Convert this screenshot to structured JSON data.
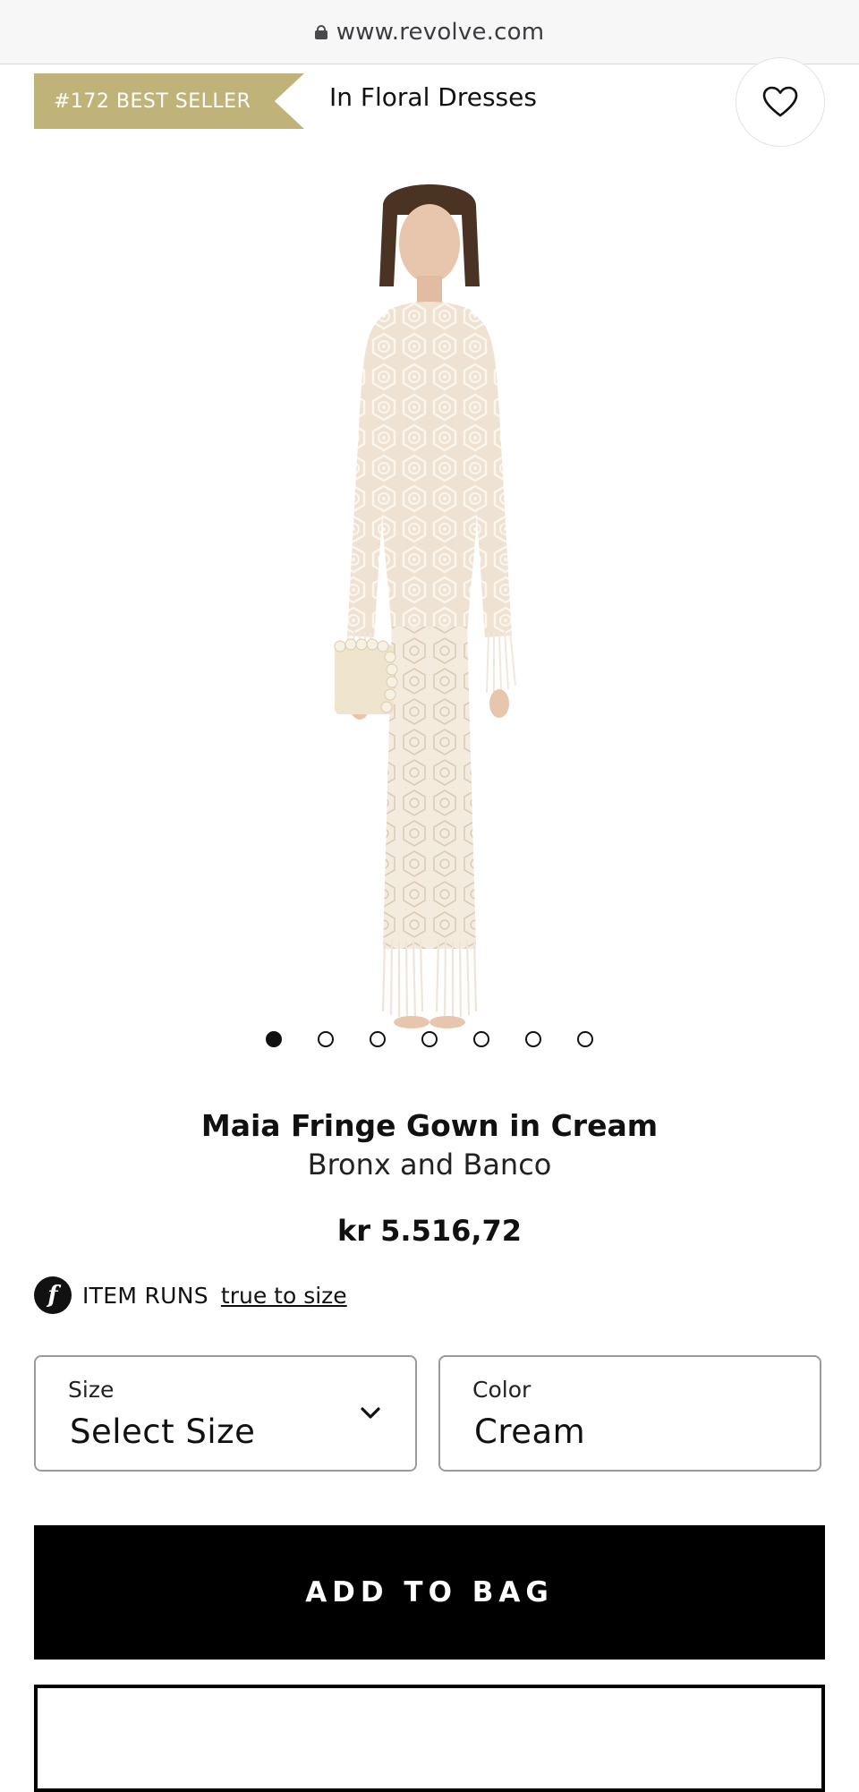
{
  "browser": {
    "url": "www.revolve.com"
  },
  "badge": {
    "label": "#172 BEST SELLER",
    "category": "In Floral Dresses"
  },
  "colors": {
    "badge_gold": "#c0b379",
    "primary_button": "#000000"
  },
  "icons": {
    "wishlist": "heart-icon",
    "lock": "lock-icon",
    "size_dropdown": "chevron-down-icon",
    "fit": "fit-logo-icon"
  },
  "gallery": {
    "image_count": 7,
    "active_index": 0
  },
  "product": {
    "name": "Maia Fringe Gown in Cream",
    "brand": "Bronx and Banco",
    "price": "kr 5.516,72"
  },
  "fit": {
    "logo_letter": "f",
    "label": "ITEM RUNS",
    "value": "true to size"
  },
  "size_select": {
    "label": "Size",
    "value": "Select Size"
  },
  "color_select": {
    "label": "Color",
    "value": "Cream"
  },
  "actions": {
    "add_to_bag": "ADD TO BAG"
  }
}
